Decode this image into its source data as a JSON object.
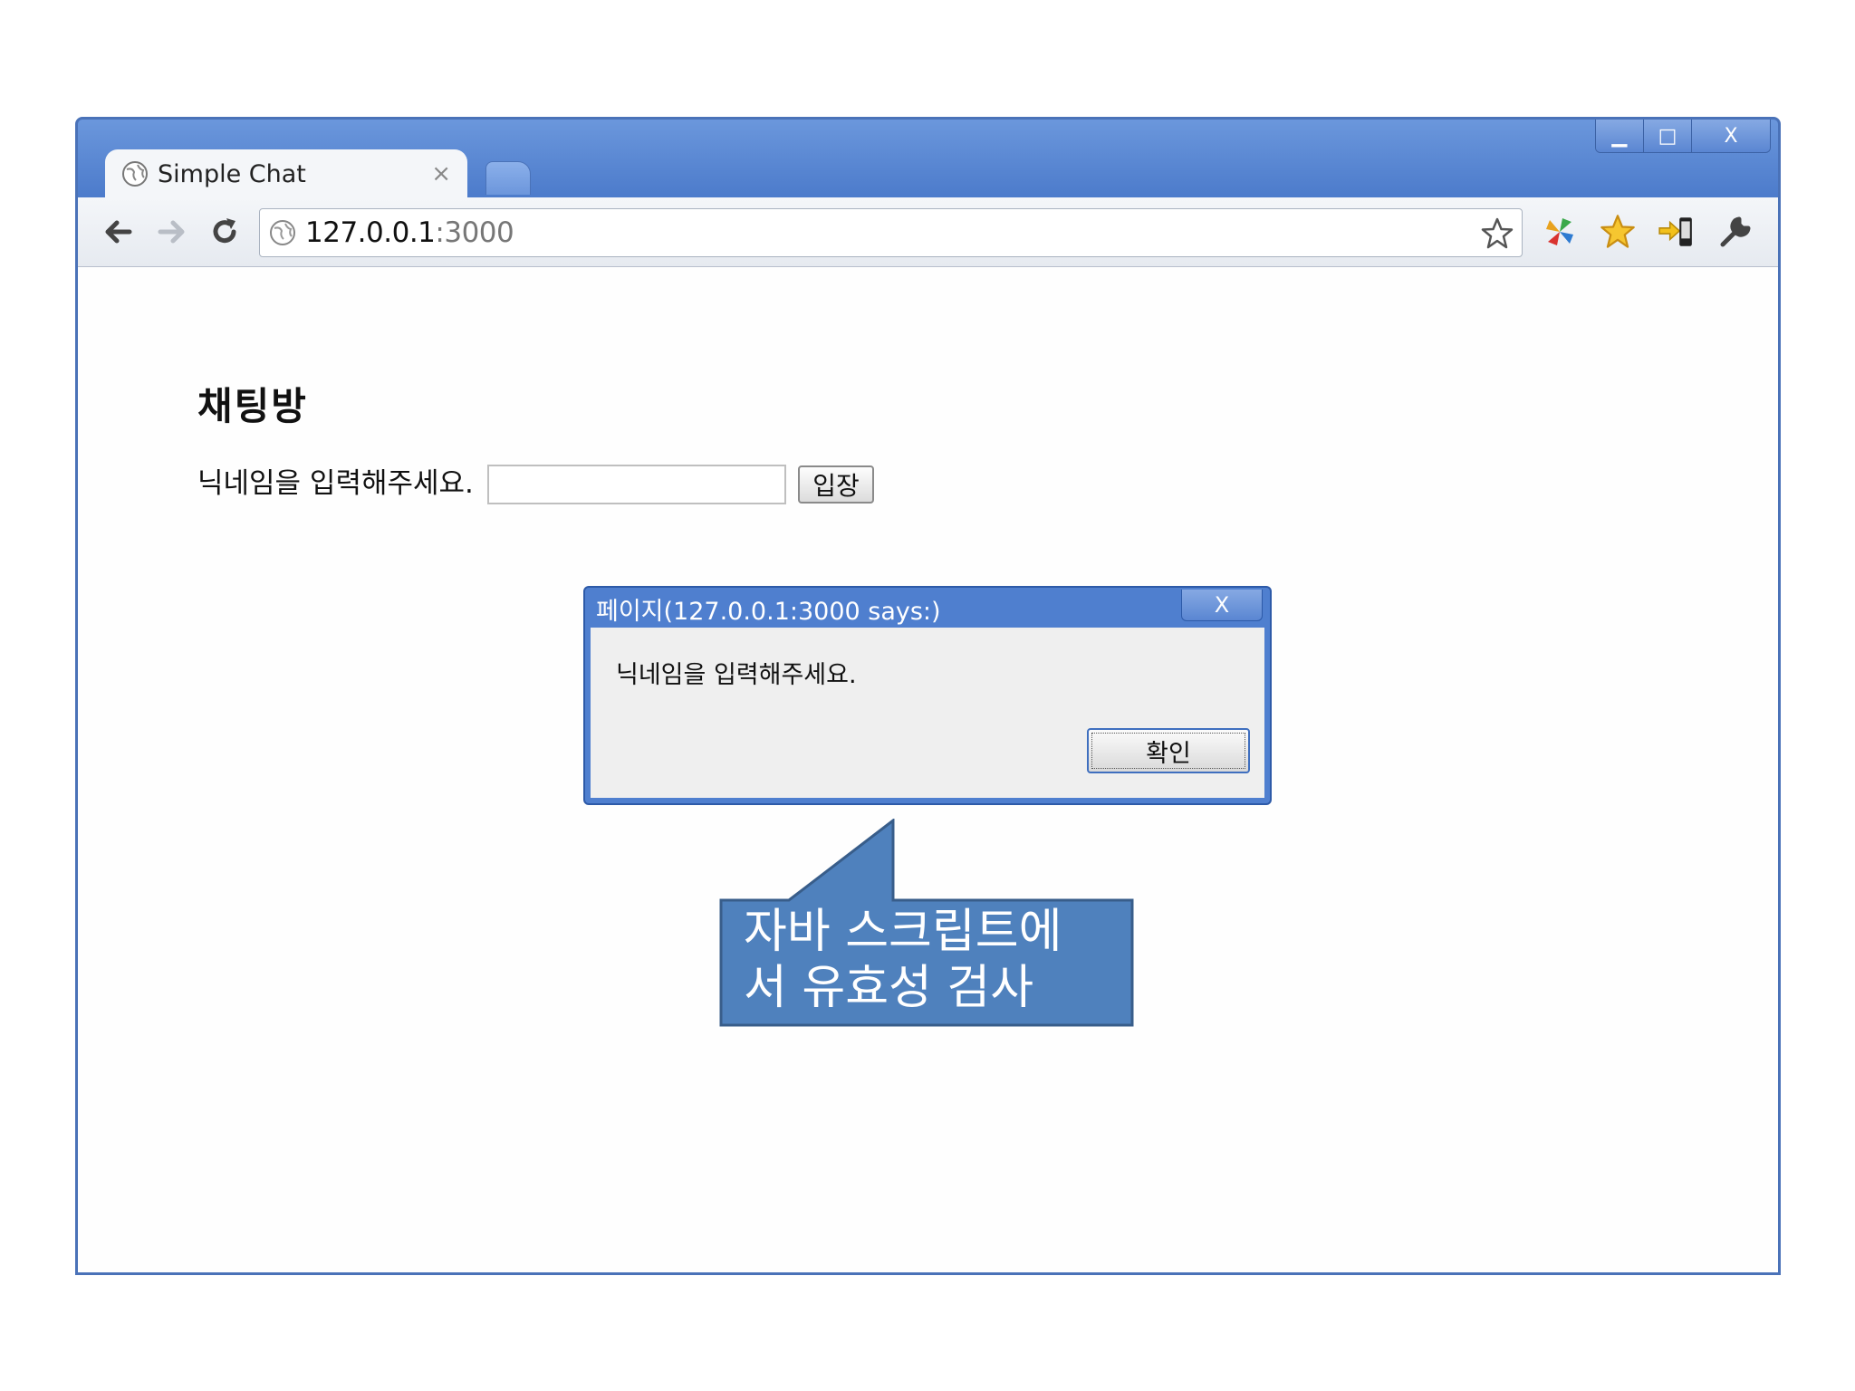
{
  "browser": {
    "tab_title": "Simple Chat",
    "tab_close": "×",
    "url_host": "127.0.0.1",
    "url_port": ":3000",
    "window_controls": {
      "minimize": "▁",
      "maximize": "□",
      "close": "X"
    }
  },
  "page": {
    "heading": "채팅방",
    "prompt": "닉네임을 입력해주세요.",
    "nickname_value": "",
    "enter_button": "입장"
  },
  "dialog": {
    "title": "페이지(127.0.0.1:3000 says:)",
    "close": "X",
    "message": "닉네임을 입력해주세요.",
    "ok_button": "확인"
  },
  "callout": {
    "text": "자바 스크립트에 서 유효성 검사"
  },
  "colors": {
    "frame": "#4f7fcf",
    "callout_fill": "#4f81bd",
    "callout_border": "#385d8a"
  }
}
